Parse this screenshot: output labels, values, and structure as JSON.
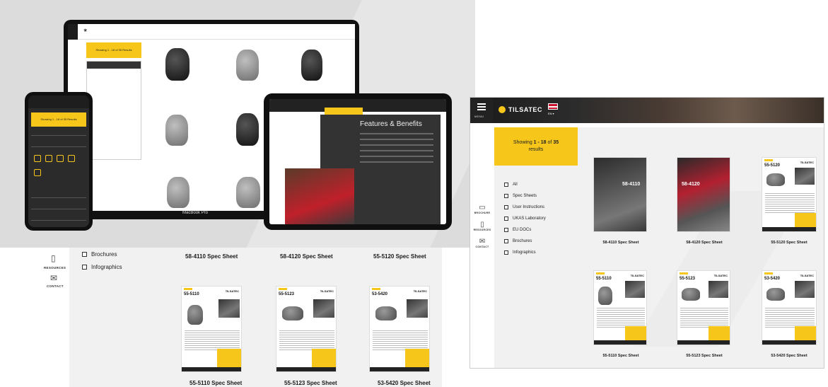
{
  "laptop": {
    "banner": "Showing 1 - 18 of 35 Results",
    "label": "MacBook Pro",
    "filters_title": "Filters"
  },
  "tablet": {
    "title": "Features & Benefits"
  },
  "phone": {
    "banner": "Showing 1 - 18 of 35 Results"
  },
  "lower_left": {
    "sidebar": [
      {
        "label": "RESOURCES",
        "icon": "phone-icon"
      },
      {
        "label": "CONTACT",
        "icon": "mail-icon"
      }
    ],
    "filters": [
      "Brochures",
      "Infographics"
    ],
    "top_captions": [
      "58-4110 Spec Sheet",
      "58-4120 Spec Sheet",
      "55-5120 Spec Sheet"
    ],
    "cards": [
      {
        "code": "55-5110",
        "brand": "TILSATEC",
        "caption": "55-5110 Spec Sheet"
      },
      {
        "code": "55-5123",
        "brand": "TILSATEC",
        "caption": "55-5123 Spec Sheet"
      },
      {
        "code": "53-5420",
        "brand": "TILSATEC",
        "caption": "53-5420 Spec Sheet"
      }
    ]
  },
  "right": {
    "menu_label": "MENU",
    "logo": "TILSATEC",
    "lang": "EN",
    "showing_prefix": "Showing",
    "showing_range": "1 - 18",
    "showing_of": "of",
    "showing_total": "35",
    "showing_suffix": "results",
    "filters": [
      "All",
      "Spec Sheets",
      "User Instructions",
      "UKAS Laboratory",
      "EU DOCs",
      "Brochures",
      "Infographics"
    ],
    "sidebar": [
      {
        "label": "BROCHURE",
        "icon": "book-icon"
      },
      {
        "label": "RESOURCES",
        "icon": "phone-icon"
      },
      {
        "label": "CONTACT",
        "icon": "mail-icon"
      }
    ],
    "row1": [
      {
        "code": "58-4110",
        "caption": "58-4110 Spec Sheet"
      },
      {
        "code": "58-4120",
        "caption": "58-4120 Spec Sheet"
      },
      {
        "code": "55-5120",
        "caption": "55-5120 Spec Sheet"
      }
    ],
    "row2": [
      {
        "code": "55-5110",
        "caption": "55-5110 Spec Sheet"
      },
      {
        "code": "55-5123",
        "caption": "55-5123 Spec Sheet"
      },
      {
        "code": "53-5420",
        "caption": "53-5420 Spec Sheet"
      }
    ],
    "brand_small": "TILSATEC"
  }
}
